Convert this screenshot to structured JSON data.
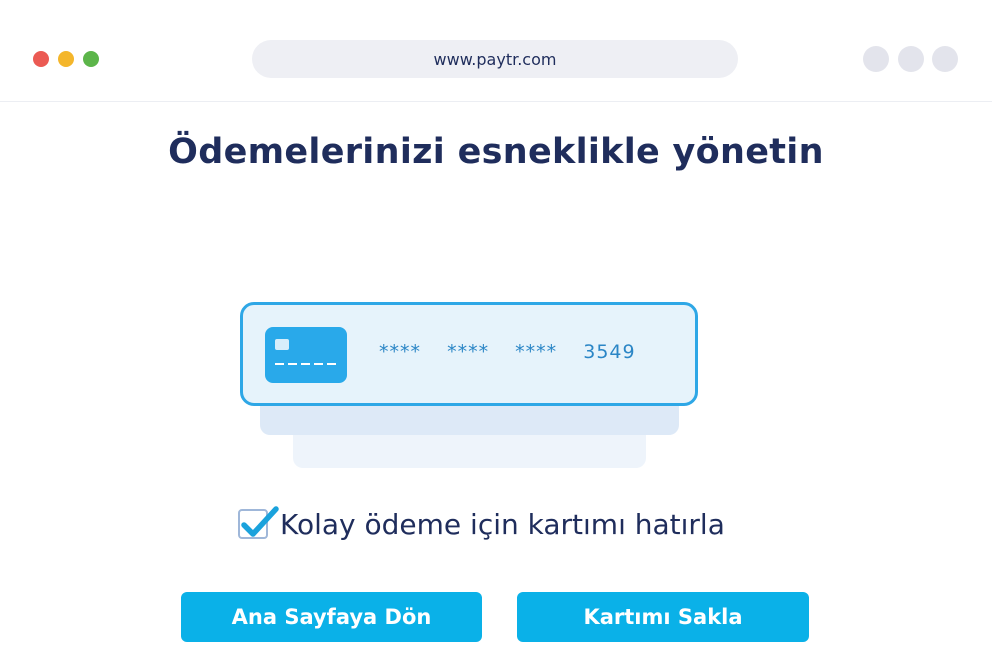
{
  "browser": {
    "url": "www.paytr.com",
    "window_dots": [
      "red",
      "yellow",
      "green"
    ],
    "colors": {
      "red": "#eb5a53",
      "yellow": "#f4b62b",
      "green": "#5cb54a"
    }
  },
  "page": {
    "title": "Ödemelerinizi esneklikle yönetin"
  },
  "card": {
    "number_masked": "****  ****  ****  3549",
    "icon": "credit-card-icon",
    "accent": "#2ea7e6"
  },
  "remember": {
    "label": "Kolay ödeme için kartımı hatırla",
    "checked": true
  },
  "buttons": {
    "home_label": "Ana Sayfaya Dön",
    "save_label": "Kartımı Sakla",
    "color": "#0ab1e8"
  }
}
